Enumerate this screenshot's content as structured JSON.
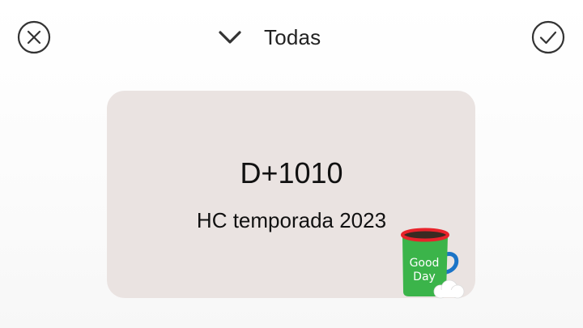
{
  "toolbar": {
    "filter_label": "Todas"
  },
  "widget": {
    "count": "D+1010",
    "title": "HC temporada 2023",
    "sticker_text": [
      "Good",
      "Day"
    ]
  },
  "icons": {
    "close": "close-circle-icon",
    "dropdown": "chevron-down-icon",
    "confirm": "check-circle-icon",
    "sticker": "coffee-mug-icon"
  },
  "colors": {
    "card_background": "#eae3e1",
    "text": "#111111",
    "icon": "#333333",
    "mug_body": "#3bb44a",
    "mug_rim": "#e8232b",
    "mug_handle": "#1b74c7"
  }
}
